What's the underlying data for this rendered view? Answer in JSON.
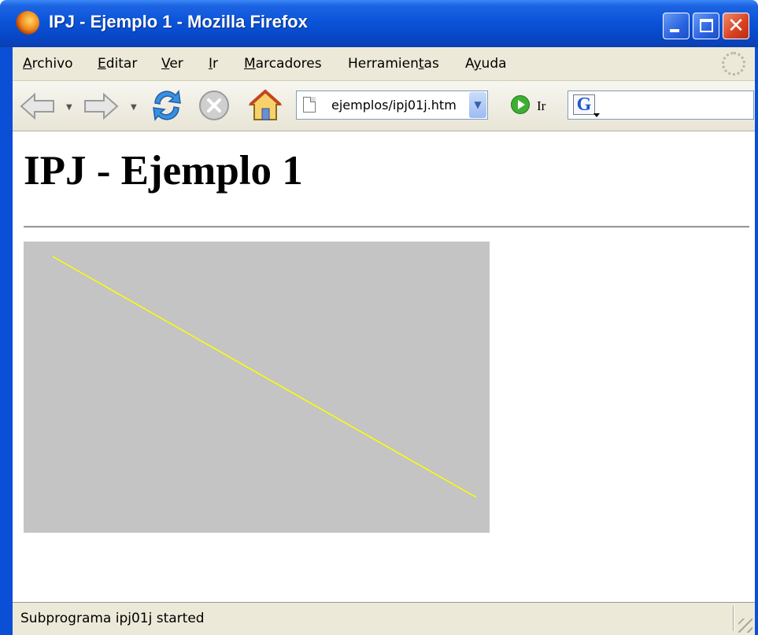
{
  "window": {
    "title": "IPJ - Ejemplo 1 - Mozilla Firefox",
    "controls": {
      "minimize": "minimize",
      "maximize": "maximize",
      "close": "close"
    }
  },
  "menubar": {
    "items": [
      {
        "label": "Archivo",
        "accesskey": "A"
      },
      {
        "label": "Editar",
        "accesskey": "E"
      },
      {
        "label": "Ver",
        "accesskey": "V"
      },
      {
        "label": "Ir",
        "accesskey": "I"
      },
      {
        "label": "Marcadores",
        "accesskey": "M"
      },
      {
        "label": "Herramientas",
        "accesskey": "t"
      },
      {
        "label": "Ayuda",
        "accesskey": "y"
      }
    ]
  },
  "toolbar": {
    "buttons": [
      "back-icon",
      "forward-icon",
      "reload-icon",
      "stop-icon",
      "home-icon"
    ],
    "url": "ejemplos/ipj01j.htm",
    "go_label": "Ir",
    "search_engine": "G"
  },
  "page": {
    "heading": "IPJ - Ejemplo 1",
    "applet": {
      "background": "#c4c4c4",
      "line_color": "#ffff00"
    }
  },
  "status": {
    "text": "Subprograma ipj01j started"
  }
}
